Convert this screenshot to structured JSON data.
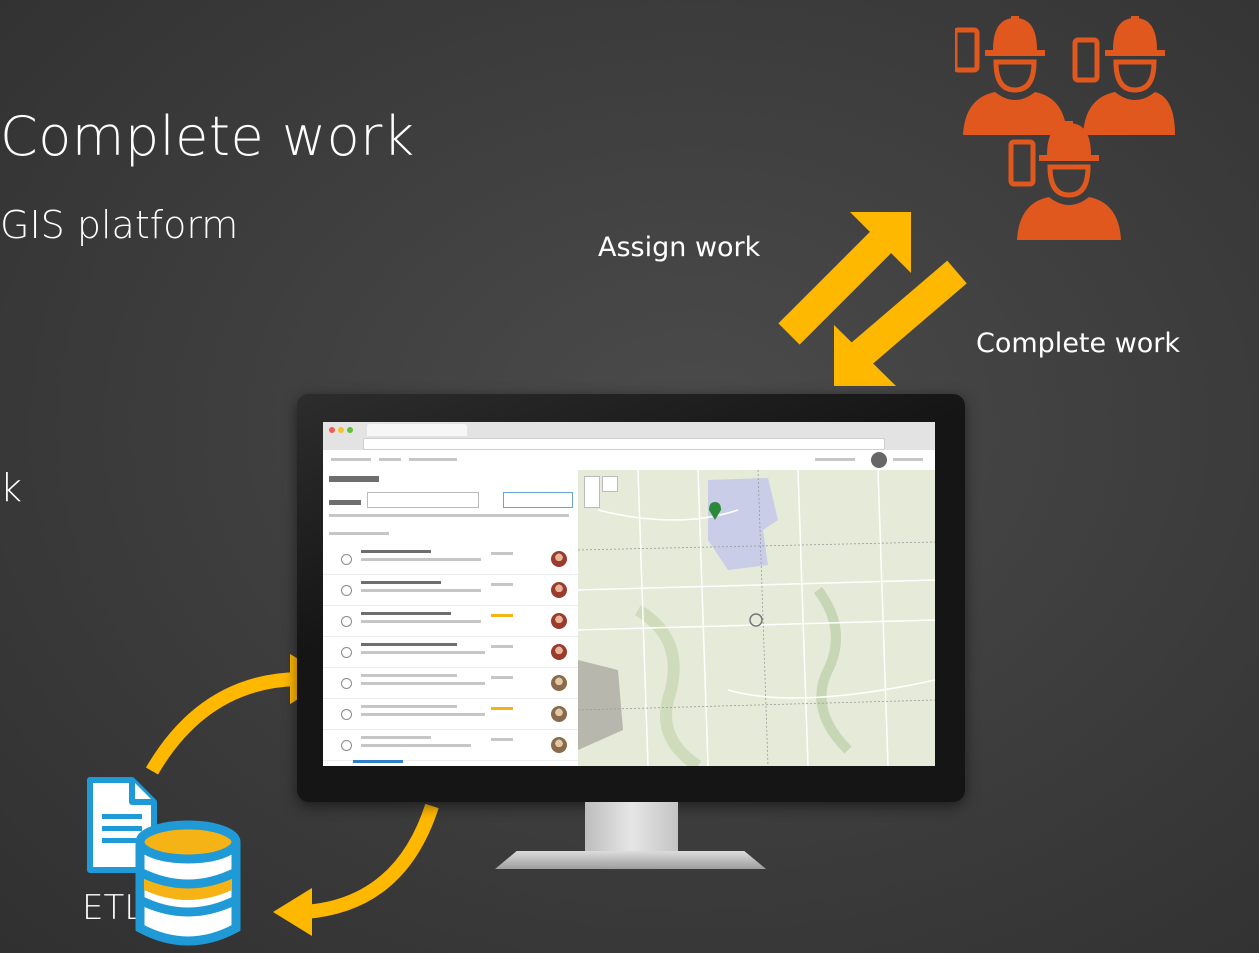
{
  "slide": {
    "title_main": "Complete work",
    "title_sub": "GIS platform",
    "title_fragment": "k"
  },
  "labels": {
    "assign_work": "Assign work",
    "complete_work": "Complete work",
    "etl": "ETL"
  },
  "colors": {
    "background": "#3c3c3c",
    "arrow": "#ffb800",
    "worker": "#e1581f",
    "database": "#1f9ad6"
  },
  "icons": {
    "workers": "mobile-worker-group-icon",
    "document": "document-icon",
    "database": "database-icon"
  }
}
